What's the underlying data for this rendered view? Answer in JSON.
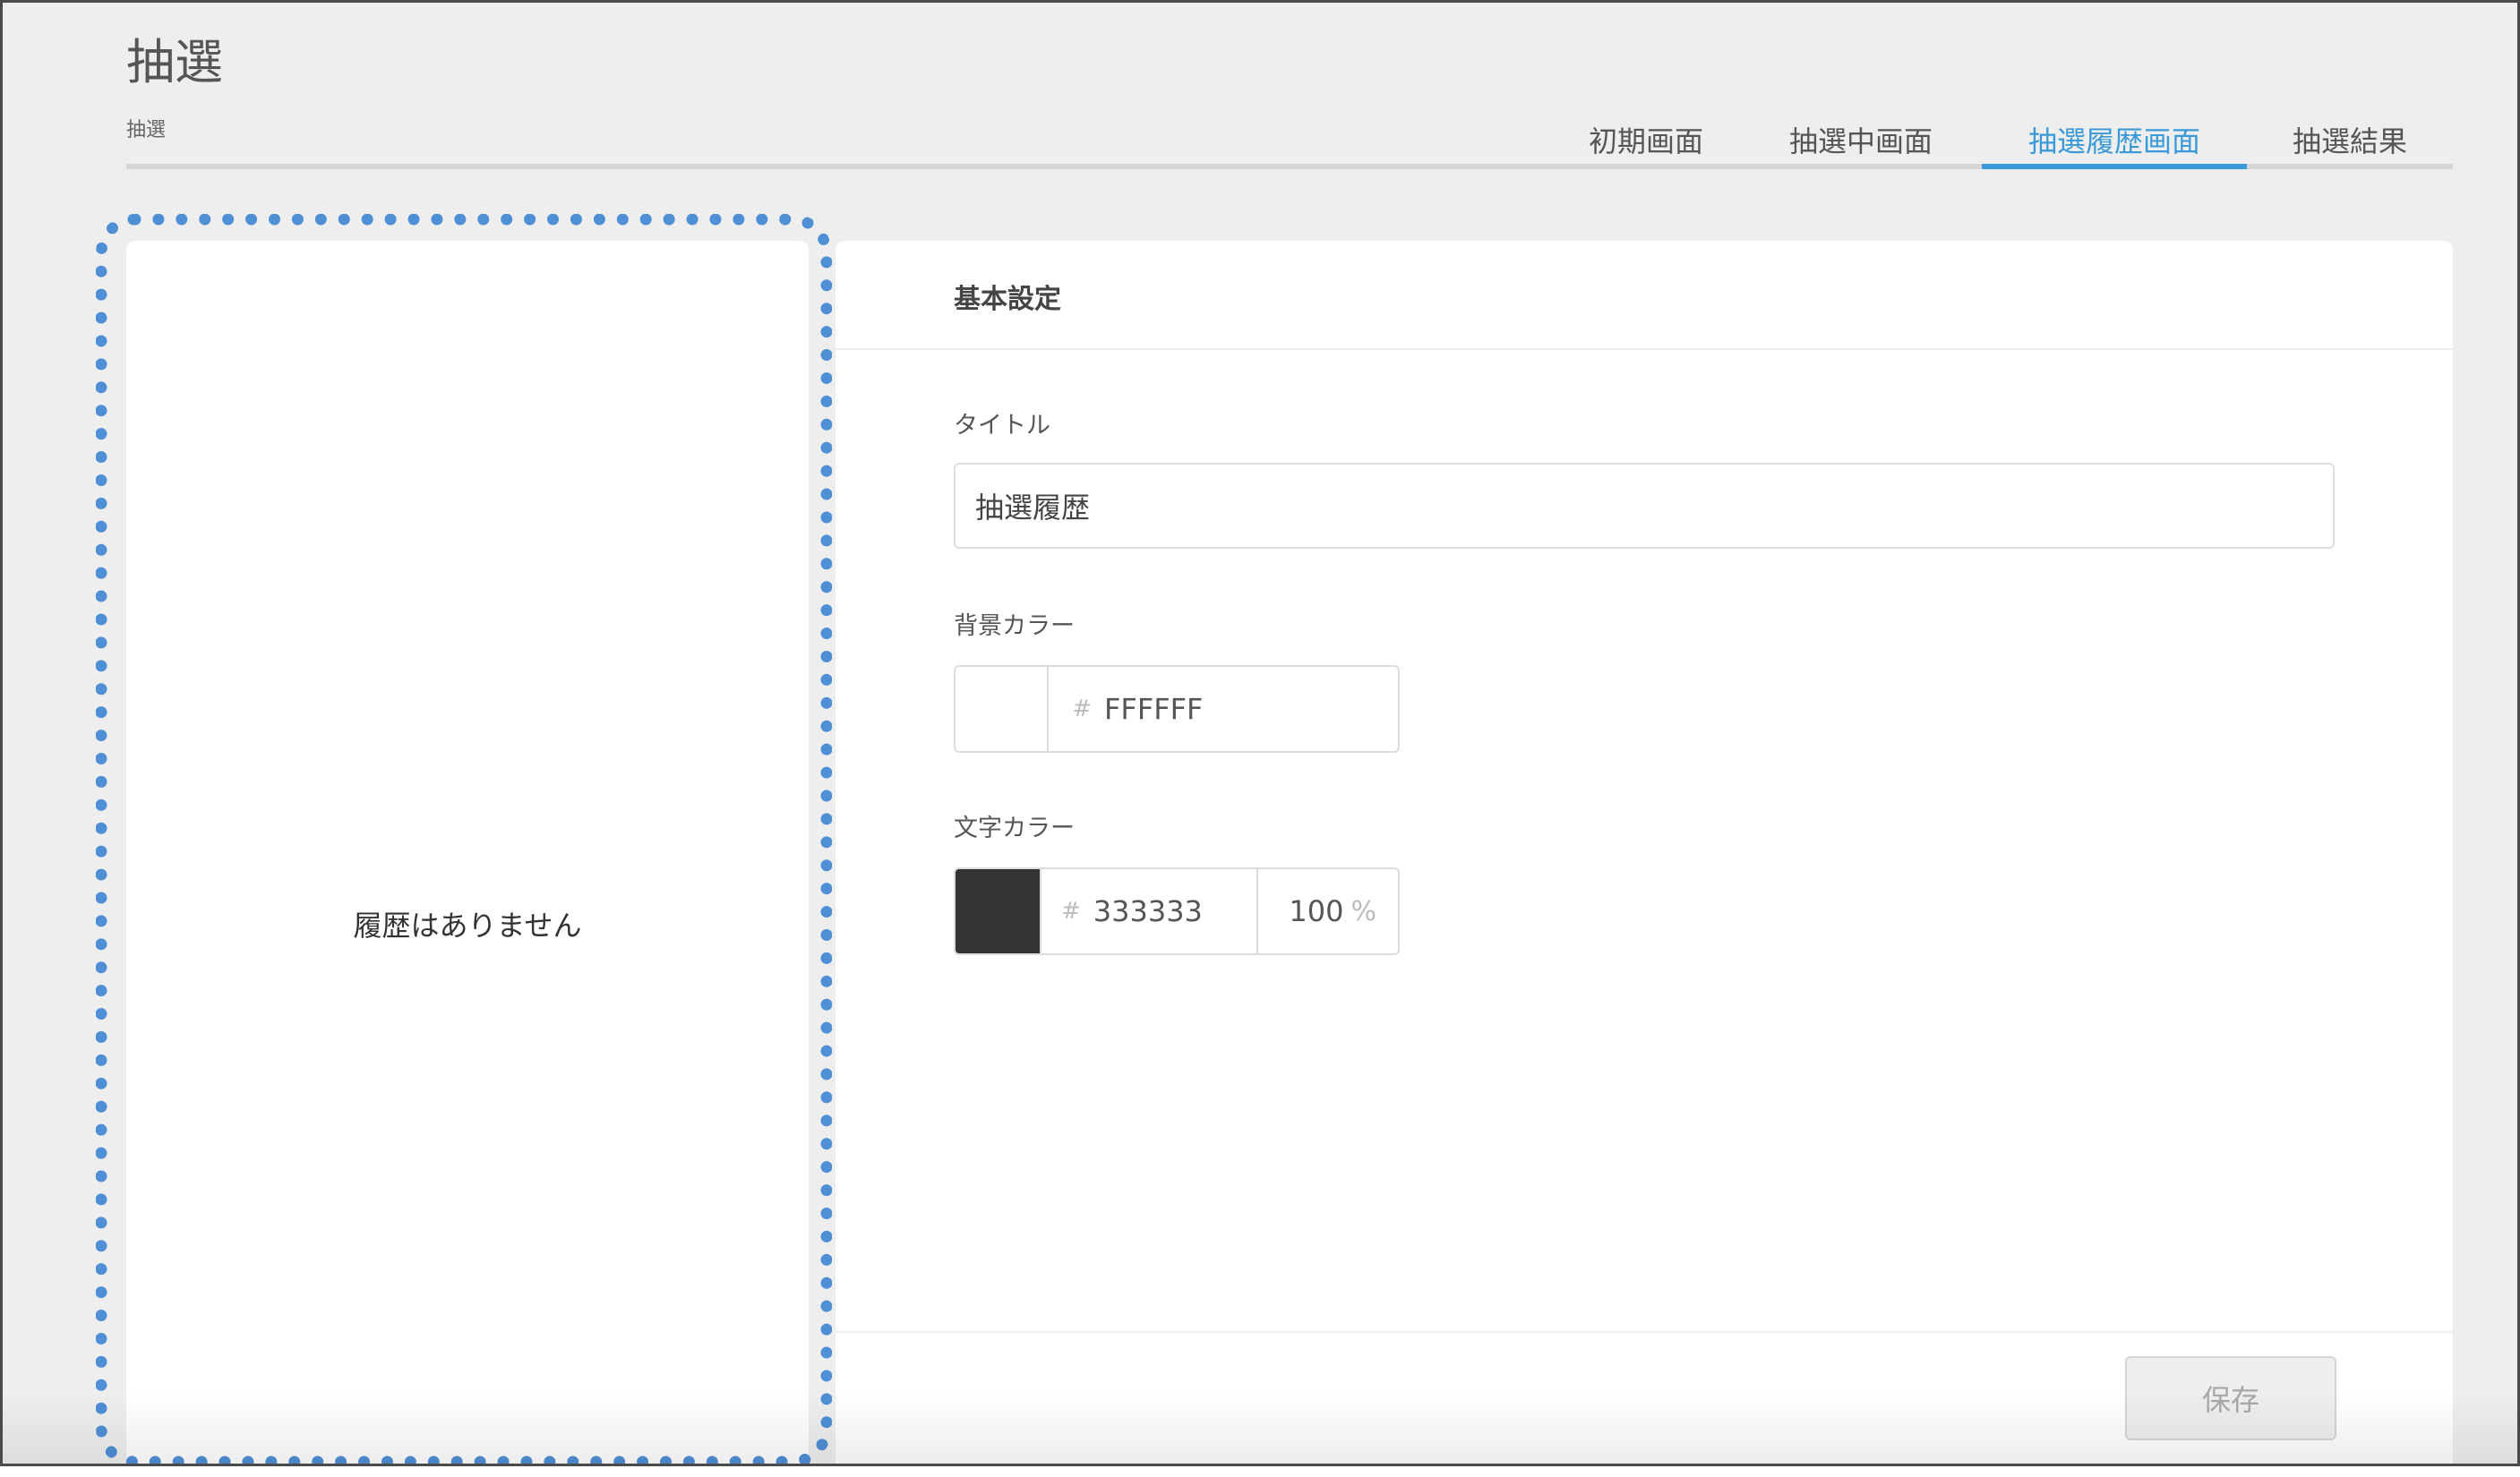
{
  "header": {
    "title": "抽選",
    "breadcrumb": "抽選"
  },
  "tabs": [
    {
      "label": "初期画面",
      "active": false
    },
    {
      "label": "抽選中画面",
      "active": false
    },
    {
      "label": "抽選履歴画面",
      "active": true
    },
    {
      "label": "抽選結果",
      "active": false
    }
  ],
  "preview": {
    "empty_message": "履歴はありません"
  },
  "settings": {
    "section_title": "基本設定",
    "title_field": {
      "label": "タイトル",
      "value": "抽選履歴"
    },
    "background_color": {
      "label": "背景カラー",
      "hash": "#",
      "value": "FFFFFF",
      "swatch": "#FFFFFF"
    },
    "text_color": {
      "label": "文字カラー",
      "hash": "#",
      "value": "333333",
      "swatch": "#333333",
      "opacity": "100",
      "opacity_unit": "%"
    },
    "save_label": "保存"
  },
  "colors": {
    "accent": "#3a9ad9",
    "highlight_outline": "#4f8fd6",
    "page_background": "#eeeeee"
  }
}
